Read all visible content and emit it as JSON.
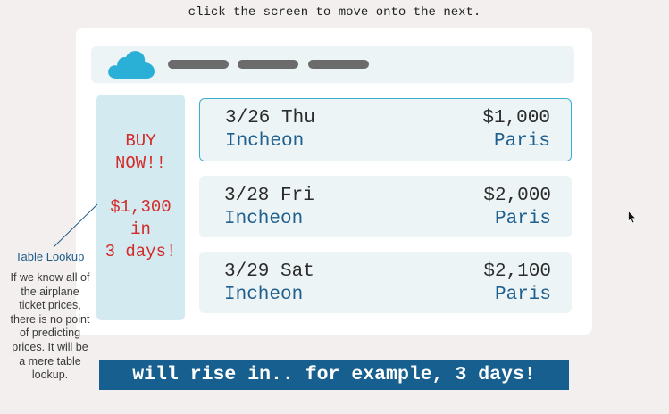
{
  "instruction": "click the screen to move onto the next.",
  "header": {
    "logo_icon": "cloud-icon",
    "accent_color": "#2ab0d6",
    "nav_items": [
      "",
      "",
      ""
    ]
  },
  "promo": {
    "line1": "BUY",
    "line2": "NOW!!",
    "line3": "$1,300",
    "line4": "in",
    "line5": "3 days!",
    "color": "#d42a2a"
  },
  "flights": [
    {
      "date": "3/26 Thu",
      "price": "$1,000",
      "origin": "Incheon",
      "destination": "Paris",
      "selected": true
    },
    {
      "date": "3/28 Fri",
      "price": "$2,000",
      "origin": "Incheon",
      "destination": "Paris",
      "selected": false
    },
    {
      "date": "3/29 Sat",
      "price": "$2,100",
      "origin": "Incheon",
      "destination": "Paris",
      "selected": false
    }
  ],
  "callout": {
    "title": "Table Lookup",
    "body": "If we know all of the airplane ticket prices, there is no point of predicting prices. It will be a mere table lookup."
  },
  "banner": {
    "text": "will rise in.. for example, 3 days!",
    "background": "#175f8f"
  },
  "cursor_icon": "mouse-pointer-icon"
}
